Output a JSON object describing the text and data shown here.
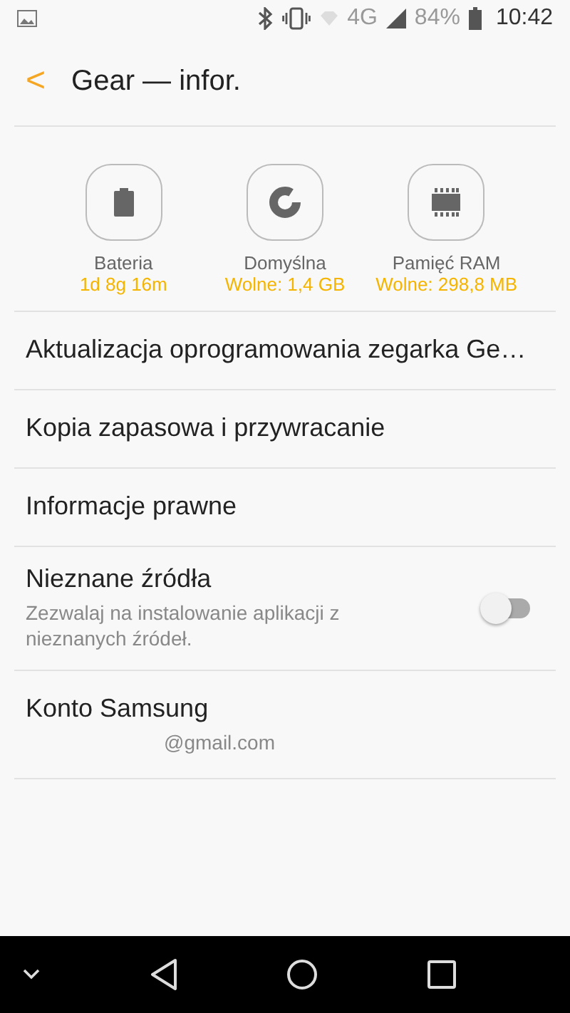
{
  "status_bar": {
    "network": "4G",
    "battery": "84%",
    "time": "10:42"
  },
  "header": {
    "back": "<",
    "title": "Gear — infor."
  },
  "stats": [
    {
      "kind": "battery",
      "label": "Bateria",
      "value": "1d 8g 16m"
    },
    {
      "kind": "storage",
      "label": "Domyślna",
      "value": "Wolne: 1,4 GB"
    },
    {
      "kind": "ram",
      "label": "Pamięć RAM",
      "value": "Wolne: 298,8 MB"
    }
  ],
  "items": [
    {
      "kind": "plain",
      "title": "Aktualizacja oprogramowania zegarka Ge…"
    },
    {
      "kind": "plain",
      "title": "Kopia zapasowa i przywracanie"
    },
    {
      "kind": "plain",
      "title": "Informacje prawne"
    },
    {
      "kind": "switch",
      "title": "Nieznane źródła",
      "subtitle": "Zezwalaj na instalowanie aplikacji z nieznanych źródeł.",
      "on": false
    },
    {
      "kind": "account",
      "title": "Konto Samsung",
      "subtitle": "@gmail.com"
    }
  ]
}
